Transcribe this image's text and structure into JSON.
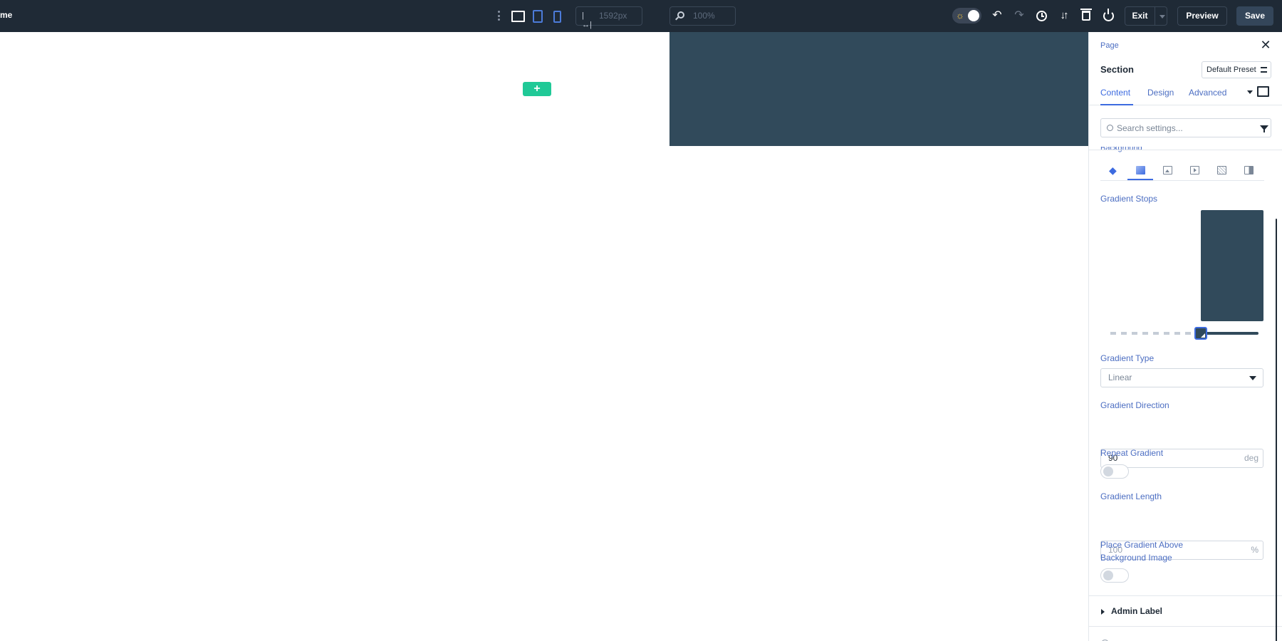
{
  "topbar": {
    "title_fragment": "me",
    "width_value": "1592px",
    "zoom_value": "100%",
    "exit_label": "Exit",
    "preview_label": "Preview",
    "save_label": "Save",
    "icons": {
      "kebab": "more-vertical-icon",
      "desktop": "desktop-view-icon",
      "tablet": "tablet-view-icon",
      "phone": "phone-view-icon",
      "width": "width-arrows-icon",
      "zoom": "zoom-icon",
      "theme": "sun-icon",
      "undo": "undo-icon",
      "redo": "redo-icon",
      "history": "clock-icon",
      "portability": "import-export-icon",
      "clear": "trash-icon",
      "disable": "power-icon"
    }
  },
  "canvas": {
    "add_row_symbol": "+",
    "section_color": "#314a5b",
    "add_color": "#20c997"
  },
  "panel": {
    "breadcrumb": "Page",
    "title": "Section",
    "preset_label": "Default Preset",
    "tabs": [
      {
        "label": "Content",
        "active": true
      },
      {
        "label": "Design",
        "active": false
      },
      {
        "label": "Advanced",
        "active": false
      }
    ],
    "search_placeholder": "Search settings...",
    "background_label": "Background",
    "background_tabs": [
      {
        "icon": "paint-bucket-icon",
        "active": false
      },
      {
        "icon": "gradient-icon",
        "active": true
      },
      {
        "icon": "image-icon",
        "active": false
      },
      {
        "icon": "video-icon",
        "active": false
      },
      {
        "icon": "pattern-icon",
        "active": false
      },
      {
        "icon": "mask-icon",
        "active": false
      }
    ],
    "gradient_stops_label": "Gradient Stops",
    "gradient_stop_color": "#314a5b",
    "gradient_type_label": "Gradient Type",
    "gradient_type_value": "Linear",
    "gradient_direction_label": "Gradient Direction",
    "gradient_direction_value": "90",
    "gradient_direction_unit": "deg",
    "repeat_gradient_label": "Repeat Gradient",
    "repeat_gradient_on": false,
    "gradient_length_label": "Gradient Length",
    "gradient_length_value": "100",
    "gradient_length_unit": "%",
    "place_above_label_1": "Place Gradient Above",
    "place_above_label_2": "Background Image",
    "place_above_on": false,
    "admin_label": "Admin Label"
  },
  "colors": {
    "accent": "#3d6be0",
    "topbar_bg": "#1f2a36",
    "label_blue": "#4c6ec2"
  }
}
